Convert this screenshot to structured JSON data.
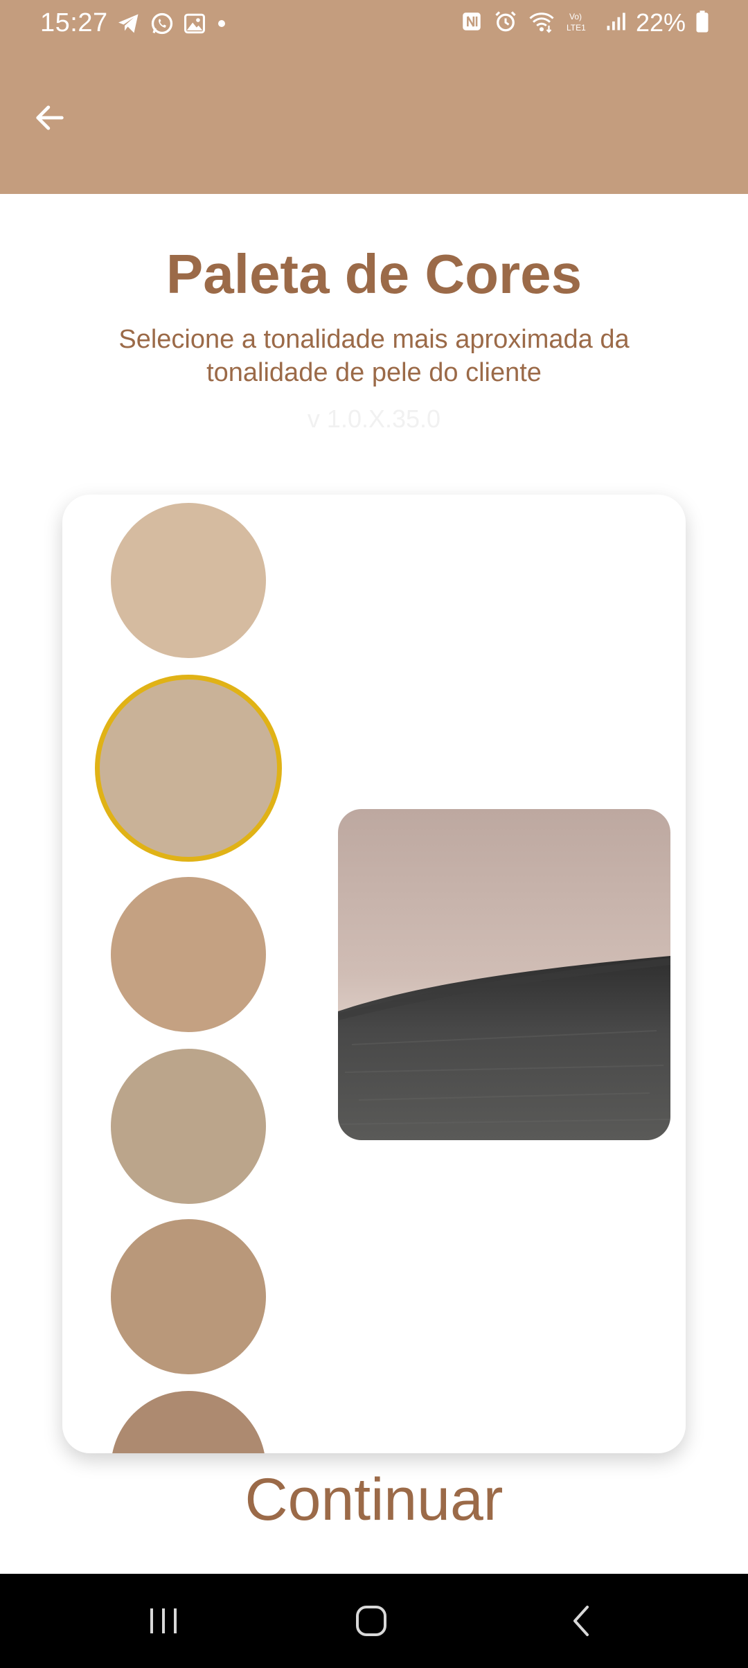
{
  "status_bar": {
    "time": "15:27",
    "battery": "22%",
    "left_icons": [
      "telegram-icon",
      "whatsapp-icon",
      "gallery-icon",
      "dot-icon"
    ],
    "right_icons": [
      "nfc-icon",
      "alarm-icon",
      "wifi-icon",
      "volte-icon",
      "signal-icon",
      "battery-icon"
    ]
  },
  "app_bar": {
    "back_icon": "arrow-left-icon",
    "color": "#c49d7e"
  },
  "header": {
    "title": "Paleta de Cores",
    "subtitle": "Selecione a tonalidade mais aproximada da tonalidade de pele do cliente",
    "version": "v 1.0.X.35.0"
  },
  "palette": {
    "selected_index": 1,
    "selected_border_color": "#e0b216",
    "swatches": [
      {
        "color": "#d5bba0"
      },
      {
        "color": "#c9b298"
      },
      {
        "color": "#c4a182"
      },
      {
        "color": "#bba58b"
      },
      {
        "color": "#b9987a"
      },
      {
        "color": "#ad8a70"
      }
    ]
  },
  "preview": {
    "image": "skin-sample-photo"
  },
  "actions": {
    "continue_label": "Continuar"
  },
  "nav_bar": {
    "buttons": [
      "recent-apps-icon",
      "home-icon",
      "back-icon"
    ]
  }
}
